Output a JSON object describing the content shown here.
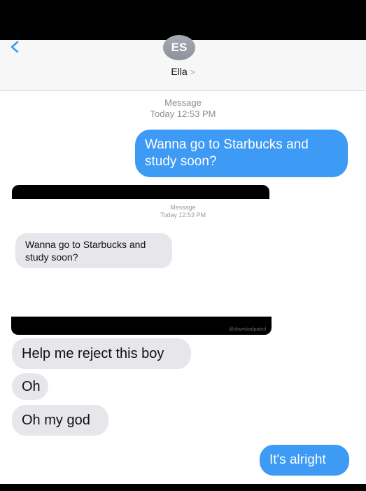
{
  "header": {
    "avatar_initials": "ES",
    "contact_name": "Ella",
    "contact_chevron": ">"
  },
  "thread": {
    "meta_top": {
      "label": "Message",
      "time": "Today 12:53 PM"
    },
    "sent_first": "Wanna go to Starbucks and study soon?",
    "embedded_screenshot": {
      "meta_label": "Message",
      "meta_time": "Today 12:53 PM",
      "bubble_text": "Wanna go to Starbucks and study soon?",
      "watermark": "@downbadpatrol"
    },
    "received": [
      "Help me reject this boy",
      "Oh",
      "Oh my god"
    ],
    "sent_last": "It's alright"
  },
  "colors": {
    "sent_bubble": "#3d9af5",
    "received_bubble": "#e6e6eb",
    "redaction_bar": "#000000"
  },
  "icons": {
    "back": "chevron-left-icon"
  }
}
